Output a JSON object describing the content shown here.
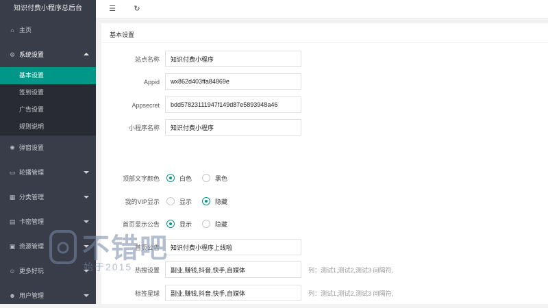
{
  "brand": "知识付费小程序总后台",
  "sidebar": {
    "home": "主页",
    "system": "系统设置",
    "system_sub": [
      "基本设置",
      "签到设置",
      "广告设置",
      "规则说明"
    ],
    "popup": "弹窗设置",
    "carousel": "轮播管理",
    "category": "分类管理",
    "card": "卡密管理",
    "resource": "资源管理",
    "more": "更多好玩",
    "user": "用户管理"
  },
  "toolbar": {
    "menu_icon": "☰",
    "refresh_icon": "↻"
  },
  "panel": {
    "title": "基本设置",
    "site_name_label": "站点名称",
    "site_name_value": "知识付费小程序",
    "appid_label": "Appid",
    "appid_value": "wx862d403ffa84869e",
    "appsecret_label": "Appsecret",
    "appsecret_value": "bdd57823111947f149d87e5893948a46",
    "miniprogram_name_label": "小程序名称",
    "miniprogram_name_value": "知识付费小程序",
    "top_text_color_label": "顶部文字颜色",
    "top_text_color_options": [
      "白色",
      "黑色"
    ],
    "top_text_color_selected": "白色",
    "my_vip_label": "我的VIP显示",
    "my_vip_options": [
      "显示",
      "隐藏"
    ],
    "my_vip_selected": "隐藏",
    "home_notice_label": "首页显示公告",
    "home_notice_options": [
      "显示",
      "隐藏"
    ],
    "home_notice_selected": "显示",
    "notice_label": "首页公告",
    "notice_value": "知识付费小程序上线啦",
    "hot_search_label": "热搜设置",
    "hot_search_value": "副业,赚钱,抖音,快手,自媒体",
    "hot_search_hint": "列：测试1,测试2,测试3 间隔符,",
    "tag_label": "标签星球",
    "tag_value": "副业,赚钱,抖音,快手,自媒体",
    "tag_hint": "列：测试1,测试2,测试3 间隔符,"
  },
  "watermark": {
    "main": "不错吧",
    "sub": "始于2015"
  },
  "colors": {
    "accent": "#009688",
    "sidebar": "#393d49"
  }
}
